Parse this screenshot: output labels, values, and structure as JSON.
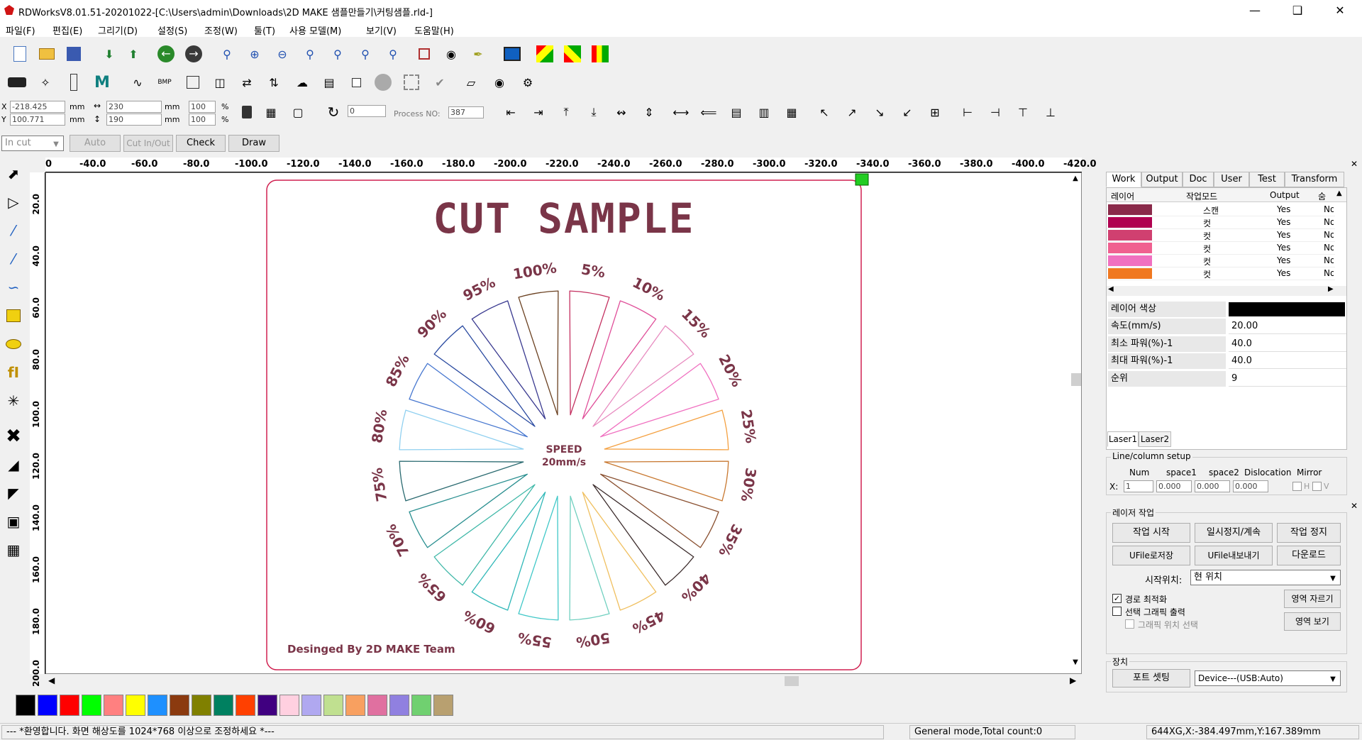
{
  "window": {
    "title": "RDWorksV8.01.51-20201022-[C:\\Users\\admin\\Downloads\\2D MAKE 샘플만들기\\커팅샘플.rld-]"
  },
  "menu": [
    "파일(F)",
    "편집(E)",
    "그리기(D)",
    "설정(S)",
    "조정(W)",
    "툴(T)",
    "사용 모델(M)",
    "보기(V)",
    "도움말(H)"
  ],
  "coords": {
    "x_label": "X",
    "y_label": "Y",
    "x": "-218.425",
    "y": "100.771",
    "unit": "mm",
    "w": "230",
    "h": "190",
    "pw": "100",
    "ph": "100",
    "pct": "%",
    "rotate": "0",
    "process_label": "Process NO:",
    "process_no": "387"
  },
  "cut_bar": {
    "mode": "In cut",
    "auto": "Auto",
    "cutinout": "Cut In/Out",
    "check": "Check",
    "draw": "Draw"
  },
  "ruler": {
    "h_ticks": [
      "0",
      "-40.0",
      "-60.0",
      "-80.0",
      "-100.0",
      "-120.0",
      "-140.0",
      "-160.0",
      "-180.0",
      "-200.0",
      "-220.0",
      "-240.0",
      "-260.0",
      "-280.0",
      "-300.0",
      "-320.0",
      "-340.0",
      "-360.0",
      "-380.0",
      "-400.0",
      "-420.0"
    ],
    "v_ticks": [
      "20.0",
      "40.0",
      "60.0",
      "80.0",
      "100.0",
      "120.0",
      "140.0",
      "160.0",
      "180.0",
      "200.0"
    ]
  },
  "design": {
    "title": "CUT SAMPLE",
    "center_line1": "SPEED",
    "center_line2": "20mm/s",
    "credit": "Desinged By 2D MAKE Team",
    "labels": [
      "5%",
      "10%",
      "15%",
      "20%",
      "25%",
      "30%",
      "35%",
      "40%",
      "45%",
      "50%",
      "55%",
      "60%",
      "65%",
      "70%",
      "75%",
      "80%",
      "85%",
      "90%",
      "95%",
      "100%"
    ],
    "segment_colors": [
      "#c43060",
      "#e0509a",
      "#e88cc0",
      "#f070c0",
      "#f4a040",
      "#c87830",
      "#8a5030",
      "#3a2a2a",
      "#f0c060",
      "#70d0c0",
      "#40c8c8",
      "#30b8b8",
      "#40b8a8",
      "#2a8f90",
      "#2a6a70",
      "#90d0f0",
      "#4878d0",
      "#2a4aa0",
      "#3a3a90",
      "#6a4020"
    ],
    "label_color": "#7a3548"
  },
  "tabs": [
    "Work",
    "Output",
    "Doc",
    "User",
    "Test",
    "Transform"
  ],
  "layers": {
    "headers": [
      "레이어",
      "작업모드",
      "Output",
      "숨"
    ],
    "rows": [
      {
        "color": "#8a2a4a",
        "mode": "스캔",
        "output": "Yes",
        "hide": "No"
      },
      {
        "color": "#b00050",
        "mode": "컷",
        "output": "Yes",
        "hide": "No"
      },
      {
        "color": "#d04070",
        "mode": "컷",
        "output": "Yes",
        "hide": "No"
      },
      {
        "color": "#f06090",
        "mode": "컷",
        "output": "Yes",
        "hide": "No"
      },
      {
        "color": "#f070c0",
        "mode": "컷",
        "output": "Yes",
        "hide": "No"
      },
      {
        "color": "#f07820",
        "mode": "컷",
        "output": "Yes",
        "hide": "No"
      }
    ]
  },
  "props": {
    "color_label": "레이어 색상",
    "speed_label": "속도(mm/s)",
    "speed": "20.00",
    "min_label": "최소 파워(%)-1",
    "min": "40.0",
    "max_label": "최대 파워(%)-1",
    "max": "40.0",
    "order_label": "순위",
    "order": "9"
  },
  "laser_tabs": [
    "Laser1",
    "Laser2"
  ],
  "linecol": {
    "title": "Line/column setup",
    "num": "Num",
    "space1": "space1",
    "space2": "space2",
    "dislocation": "Dislocation",
    "mirror": "Mirror",
    "x": "X:",
    "vnum": "1",
    "vs1": "0.000",
    "vs2": "0.000",
    "vdis": "0.000",
    "h": "H",
    "v": "V"
  },
  "laser_work": {
    "title": "레이저 작업",
    "start": "작업 시작",
    "pause": "일시정지/계속",
    "stop": "작업 정지",
    "ufile_save": "UFile로저장",
    "ufile_export": "UFile내보내기",
    "download": "다운로드",
    "start_pos_label": "시작위치:",
    "start_pos": "현 위치",
    "opt_path": "경로 최적화",
    "sel_output": "선택 그래픽 출력",
    "sel_pos": "그래픽 위치 선택",
    "cut_area": "영역 자르기",
    "view_area": "영역 보기"
  },
  "device": {
    "title": "장치",
    "port": "포트 셋팅",
    "device": "Device---(USB:Auto)"
  },
  "palette": [
    "#000000",
    "#0000ff",
    "#ff0000",
    "#00ff00",
    "#ff8080",
    "#ffff00",
    "#1e90ff",
    "#8b3a0f",
    "#808000",
    "#008060",
    "#ff4000",
    "#400080",
    "#ffd0e0",
    "#b0a8f0",
    "#c0e090",
    "#f8a060",
    "#e070a0",
    "#9080e0",
    "#70d070",
    "#b8a070"
  ],
  "status": {
    "left": "--- *환영합니다. 화면 해상도를 1024*768 이상으로 조정하세요 *---",
    "mode": "General mode,Total count:0",
    "pos": "644XG,X:-384.497mm,Y:167.389mm"
  }
}
